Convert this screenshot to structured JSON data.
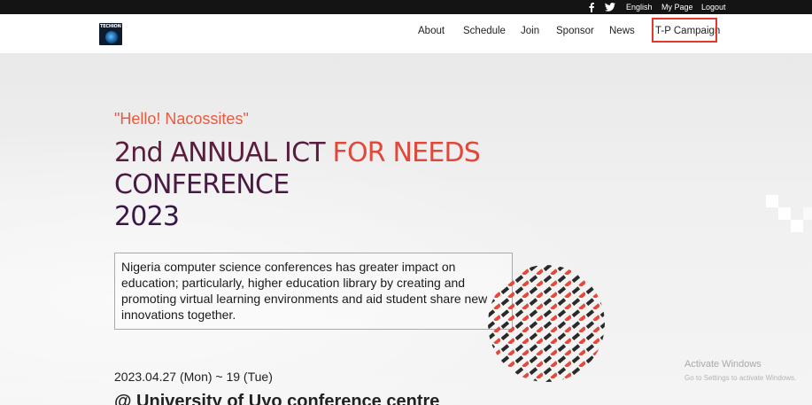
{
  "topbar": {
    "social": [
      "facebook-icon",
      "twitter-icon"
    ],
    "language": "English",
    "my_page": "My Page",
    "logout": "Logout"
  },
  "logo": {
    "text": "TECHION"
  },
  "nav": {
    "items": [
      "About",
      "Schedule",
      "Join",
      "Sponsor",
      "News",
      "T-P Campaign"
    ],
    "highlight_color": "#e2392c"
  },
  "hero": {
    "greeting": "\"Hello! Nacossites\"",
    "title_line1_a": "2nd ANNUAL ICT ",
    "title_line1_b": "FOR NEEDS",
    "title_line2": "CONFERENCE",
    "title_line3": "2023",
    "description": "Nigeria computer science conferences has greater impact on education; particularly, higher education library by creating and promoting virtual learning environments and aid student share new innovations together.",
    "date": "2023.04.27 (Mon) ~ 19 (Tue)",
    "venue": "@ University of Uyo conference centre"
  },
  "watermark": {
    "line1": "Activate Windows",
    "line2": "Go to Settings to activate Windows."
  },
  "colors": {
    "accent_red": "#e0483a",
    "title_purple": "#4a1a44",
    "dark": "#141414"
  }
}
